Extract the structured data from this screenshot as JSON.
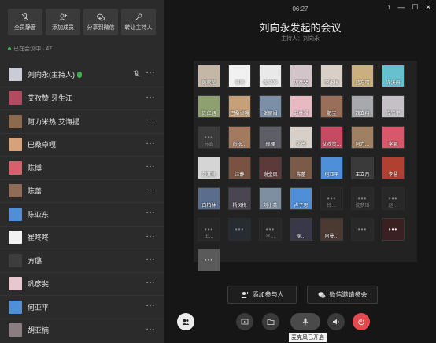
{
  "toolbar": {
    "buttons": [
      {
        "label": "全员静音",
        "icon": "mic-off-icon"
      },
      {
        "label": "添加成员",
        "icon": "add-user-icon"
      },
      {
        "label": "分享到微信",
        "icon": "wechat-icon"
      },
      {
        "label": "转让主持人",
        "icon": "key-icon"
      }
    ]
  },
  "participants": {
    "count_label": "已在会议中 · 47",
    "members": [
      {
        "name": "刘向永(主持人)",
        "color": "#c9ccd6",
        "mic_on": true
      },
      {
        "name": "艾孜赞·牙生江",
        "color": "#b34a60"
      },
      {
        "name": "阿力米热·艾海提",
        "color": "#8c6a4e"
      },
      {
        "name": "巴桑卓嘎",
        "color": "#d7a27a"
      },
      {
        "name": "陈博",
        "color": "#d85f6b"
      },
      {
        "name": "陈蕾",
        "color": "#8e6c57"
      },
      {
        "name": "陈亚东",
        "color": "#4f8fd8"
      },
      {
        "name": "崔咚咚",
        "color": "#f2f2f2"
      },
      {
        "name": "方璐",
        "color": "#3d3d3d"
      },
      {
        "name": "巩彦斐",
        "color": "#e8c8d0"
      },
      {
        "name": "何亚平",
        "color": "#4f8fd8"
      },
      {
        "name": "胡亚楠",
        "color": "#8a7e80"
      }
    ],
    "more_label": "···"
  },
  "meeting": {
    "time": "06:27",
    "title": "刘向永发起的会议",
    "host": "主持人：刘向永",
    "tiles": [
      {
        "name": "黄欢莹",
        "color": "#c4b7a6"
      },
      {
        "name": "嗯嗯",
        "color": "#f1f1f1"
      },
      {
        "name": "崔咚咚",
        "color": "#e9e9e9"
      },
      {
        "name": "巩彦斐",
        "color": "#d2c4c8"
      },
      {
        "name": "李永梅",
        "color": "#d8cfc6"
      },
      {
        "name": "蓝方晴",
        "color": "#c9b07e"
      },
      {
        "name": "许溪丹",
        "color": "#65c1cf"
      },
      {
        "name": "庞仁涵",
        "color": "#8ea06f"
      },
      {
        "name": "巴桑卓嘎",
        "color": "#c5a078"
      },
      {
        "name": "张丽娟",
        "color": "#7b8fa6"
      },
      {
        "name": "赵林湘",
        "color": "#e6b9c3"
      },
      {
        "name": "肥宝",
        "color": "#9a6f5a"
      },
      {
        "name": "魏立翔",
        "color": "#a8a9ad"
      },
      {
        "name": "库雪宁",
        "color": "#c4c0c6"
      },
      {
        "name": "苏鑫",
        "color": "#5a5a5a",
        "off": true
      },
      {
        "name": "热依…",
        "color": "#a27a5e"
      },
      {
        "name": "邢骊",
        "color": "#5e5e66"
      },
      {
        "name": "张薇",
        "color": "#d7d0c8"
      },
      {
        "name": "艾孜赞…",
        "color": "#c54b63"
      },
      {
        "name": "阿力…",
        "color": "#a08062"
      },
      {
        "name": "李颖",
        "color": "#d6586a"
      },
      {
        "name": "刘其楠",
        "color": "#d5d5d5"
      },
      {
        "name": "汪静",
        "color": "#7a5242"
      },
      {
        "name": "谢金凤",
        "color": "#5d3a3a"
      },
      {
        "name": "陈蕾",
        "color": "#7b5a48"
      },
      {
        "name": "何亚平",
        "color": "#4f8fd8"
      },
      {
        "name": "王立月",
        "color": "#3a3a3a"
      },
      {
        "name": "李慧",
        "color": "#b0402f"
      },
      {
        "name": "白柏林",
        "color": "#5a6d8c"
      },
      {
        "name": "杨凤梅",
        "color": "#4a4550"
      },
      {
        "name": "刘小英",
        "color": "#7d8fa0"
      },
      {
        "name": "卢子思",
        "color": "#4f8fd8"
      },
      {
        "name": "徐…",
        "color": "#2c2c2c",
        "off": true
      },
      {
        "name": "沈梦瑶",
        "color": "#303030",
        "off": true
      },
      {
        "name": "赵…",
        "color": "#303030",
        "off": true
      },
      {
        "name": "王…",
        "color": "#2e2e2e",
        "off": true
      },
      {
        "name": "",
        "color": "#2f3a48",
        "off": true
      },
      {
        "name": "李…",
        "color": "#2e2e2e",
        "off": true
      },
      {
        "name": "侯…",
        "color": "#383848"
      },
      {
        "name": "阿曼…",
        "color": "#4a3a32"
      },
      {
        "name": "",
        "color": "#303030",
        "off": true
      },
      {
        "name": "",
        "color": "#3a2020"
      },
      {
        "name": "",
        "color": "#5a5a5a"
      }
    ],
    "add_participant": "添加参与人",
    "invite_wechat": "微信邀请参会",
    "mic_tooltip": "麦克风已开启"
  },
  "colors": {
    "accent_green": "#3db14f",
    "hangup": "#e5484d"
  }
}
